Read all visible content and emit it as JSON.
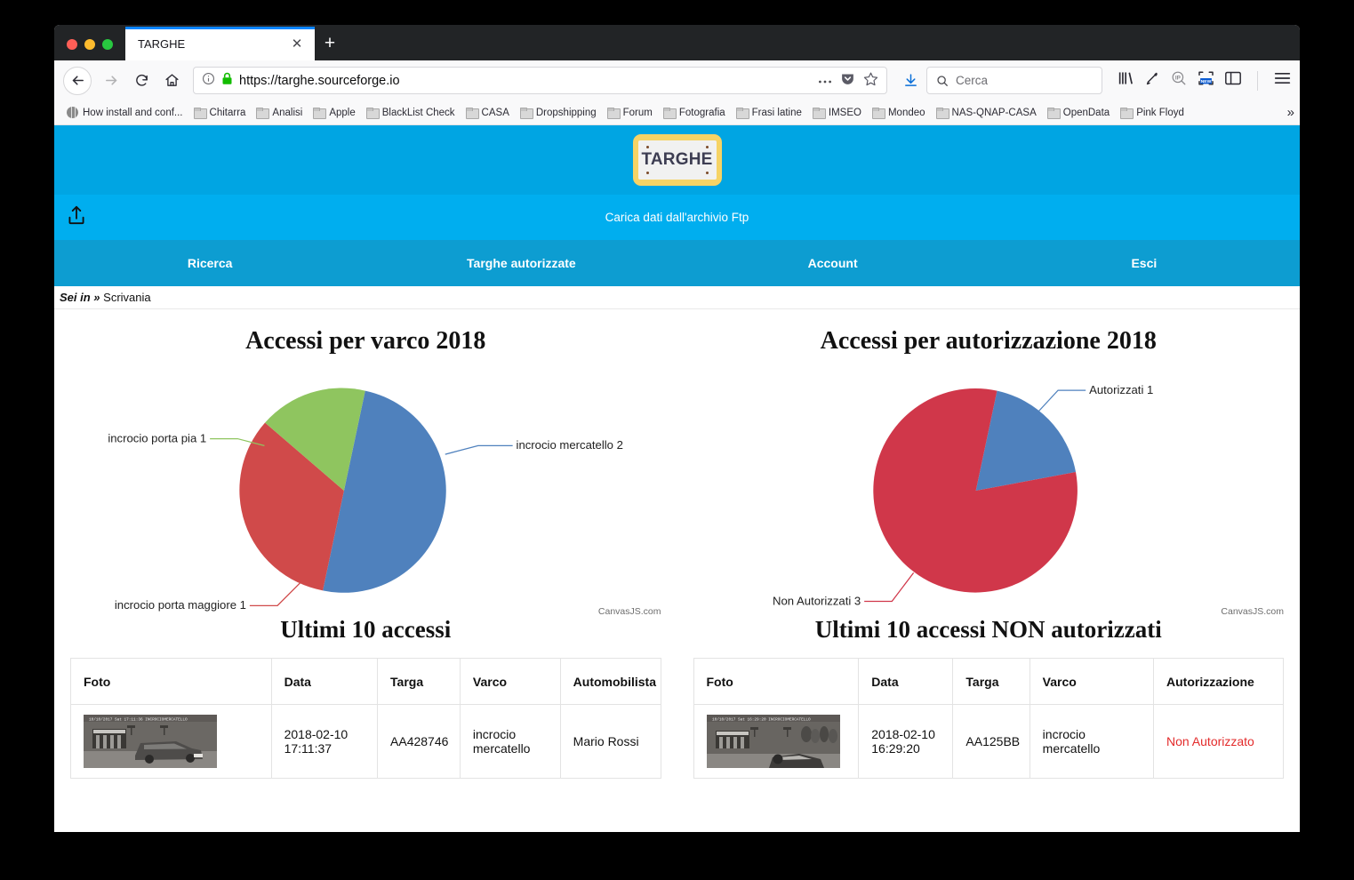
{
  "browser": {
    "tab_title": "TARGHE",
    "new_tab_label": "+",
    "close_label": "✕",
    "url": "https://targhe.sourceforge.io",
    "search_placeholder": "Cerca",
    "bookmarks": [
      {
        "label": "How install and conf...",
        "icon": "globe-icon"
      },
      {
        "label": "Chitarra",
        "icon": "folder-icon"
      },
      {
        "label": "Analisi",
        "icon": "folder-icon"
      },
      {
        "label": "Apple",
        "icon": "folder-icon"
      },
      {
        "label": "BlackList Check",
        "icon": "folder-icon"
      },
      {
        "label": "CASA",
        "icon": "folder-icon"
      },
      {
        "label": "Dropshipping",
        "icon": "folder-icon"
      },
      {
        "label": "Forum",
        "icon": "folder-icon"
      },
      {
        "label": "Fotografia",
        "icon": "folder-icon"
      },
      {
        "label": "Frasi latine",
        "icon": "folder-icon"
      },
      {
        "label": "IMSEO",
        "icon": "folder-icon"
      },
      {
        "label": "Mondeo",
        "icon": "folder-icon"
      },
      {
        "label": "NAS-QNAP-CASA",
        "icon": "folder-icon"
      },
      {
        "label": "OpenData",
        "icon": "folder-icon"
      },
      {
        "label": "Pink Floyd",
        "icon": "folder-icon"
      }
    ],
    "bookmarks_overflow": "»"
  },
  "site": {
    "logo_text": "TARGHE",
    "upload_bar_label": "Carica dati dall'archivio Ftp",
    "nav": [
      {
        "label": "Ricerca"
      },
      {
        "label": "Targhe autorizzate"
      },
      {
        "label": "Account"
      },
      {
        "label": "Esci"
      }
    ],
    "breadcrumb_prefix": "Sei in »",
    "breadcrumb_current": "Scrivania",
    "colors": {
      "header_blue": "#00a5e3",
      "upload_blue": "#00aeef",
      "nav_blue": "#0d9dd1",
      "plate_gold": "#f6d365",
      "denied_red": "#e32b2b"
    }
  },
  "chart_data": [
    {
      "type": "pie",
      "title": "Accessi per varco 2018",
      "credit": "CanvasJS.com",
      "legend": "none",
      "labels": [
        "incrocio mercatello 2",
        "incrocio porta pia 1",
        "incrocio porta maggiore 1"
      ],
      "categories": [
        "incrocio mercatello",
        "incrocio porta pia",
        "incrocio porta maggiore"
      ],
      "values": [
        2,
        1,
        1
      ],
      "colors": [
        "#4f81bd",
        "#8fc55f",
        "#d04a4a"
      ],
      "percentages": [
        50,
        25,
        25
      ]
    },
    {
      "type": "pie",
      "title": "Accessi per autorizzazione 2018",
      "credit": "CanvasJS.com",
      "legend": "none",
      "labels": [
        "Autorizzati 1",
        "Non Autorizzati 3"
      ],
      "categories": [
        "Autorizzati",
        "Non Autorizzati"
      ],
      "values": [
        1,
        3
      ],
      "colors": [
        "#4f81bd",
        "#d0374a"
      ],
      "percentages": [
        25,
        75
      ]
    }
  ],
  "tables": {
    "accessi": {
      "title": "Ultimi 10 accessi",
      "columns": [
        "Foto",
        "Data",
        "Targa",
        "Varco",
        "Automobilista"
      ],
      "rows": [
        {
          "foto": "cctv-photo-car",
          "data": "2018-02-10 17:11:37",
          "targa": "AA428746",
          "varco": "incrocio mercatello",
          "automobilista": "Mario Rossi"
        }
      ]
    },
    "non_autorizzati": {
      "title": "Ultimi 10 accessi NON autorizzati",
      "columns": [
        "Foto",
        "Data",
        "Targa",
        "Varco",
        "Autorizzazione"
      ],
      "rows": [
        {
          "foto": "cctv-photo-car",
          "data": "2018-02-10 16:29:20",
          "targa": "AA125BB",
          "varco": "incrocio mercatello",
          "autorizzazione": "Non Autorizzato"
        }
      ]
    }
  }
}
